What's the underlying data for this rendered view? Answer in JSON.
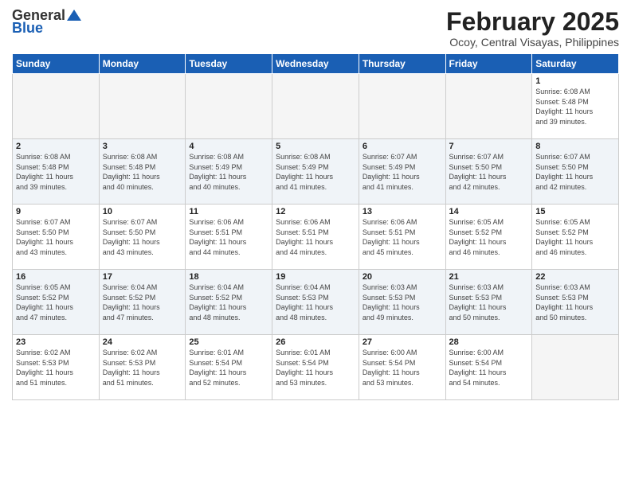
{
  "logo": {
    "general": "General",
    "blue": "Blue"
  },
  "header": {
    "month_year": "February 2025",
    "location": "Ocoy, Central Visayas, Philippines"
  },
  "weekdays": [
    "Sunday",
    "Monday",
    "Tuesday",
    "Wednesday",
    "Thursday",
    "Friday",
    "Saturday"
  ],
  "weeks": [
    [
      {
        "day": "",
        "info": ""
      },
      {
        "day": "",
        "info": ""
      },
      {
        "day": "",
        "info": ""
      },
      {
        "day": "",
        "info": ""
      },
      {
        "day": "",
        "info": ""
      },
      {
        "day": "",
        "info": ""
      },
      {
        "day": "1",
        "info": "Sunrise: 6:08 AM\nSunset: 5:48 PM\nDaylight: 11 hours\nand 39 minutes."
      }
    ],
    [
      {
        "day": "2",
        "info": "Sunrise: 6:08 AM\nSunset: 5:48 PM\nDaylight: 11 hours\nand 39 minutes."
      },
      {
        "day": "3",
        "info": "Sunrise: 6:08 AM\nSunset: 5:48 PM\nDaylight: 11 hours\nand 40 minutes."
      },
      {
        "day": "4",
        "info": "Sunrise: 6:08 AM\nSunset: 5:49 PM\nDaylight: 11 hours\nand 40 minutes."
      },
      {
        "day": "5",
        "info": "Sunrise: 6:08 AM\nSunset: 5:49 PM\nDaylight: 11 hours\nand 41 minutes."
      },
      {
        "day": "6",
        "info": "Sunrise: 6:07 AM\nSunset: 5:49 PM\nDaylight: 11 hours\nand 41 minutes."
      },
      {
        "day": "7",
        "info": "Sunrise: 6:07 AM\nSunset: 5:50 PM\nDaylight: 11 hours\nand 42 minutes."
      },
      {
        "day": "8",
        "info": "Sunrise: 6:07 AM\nSunset: 5:50 PM\nDaylight: 11 hours\nand 42 minutes."
      }
    ],
    [
      {
        "day": "9",
        "info": "Sunrise: 6:07 AM\nSunset: 5:50 PM\nDaylight: 11 hours\nand 43 minutes."
      },
      {
        "day": "10",
        "info": "Sunrise: 6:07 AM\nSunset: 5:50 PM\nDaylight: 11 hours\nand 43 minutes."
      },
      {
        "day": "11",
        "info": "Sunrise: 6:06 AM\nSunset: 5:51 PM\nDaylight: 11 hours\nand 44 minutes."
      },
      {
        "day": "12",
        "info": "Sunrise: 6:06 AM\nSunset: 5:51 PM\nDaylight: 11 hours\nand 44 minutes."
      },
      {
        "day": "13",
        "info": "Sunrise: 6:06 AM\nSunset: 5:51 PM\nDaylight: 11 hours\nand 45 minutes."
      },
      {
        "day": "14",
        "info": "Sunrise: 6:05 AM\nSunset: 5:52 PM\nDaylight: 11 hours\nand 46 minutes."
      },
      {
        "day": "15",
        "info": "Sunrise: 6:05 AM\nSunset: 5:52 PM\nDaylight: 11 hours\nand 46 minutes."
      }
    ],
    [
      {
        "day": "16",
        "info": "Sunrise: 6:05 AM\nSunset: 5:52 PM\nDaylight: 11 hours\nand 47 minutes."
      },
      {
        "day": "17",
        "info": "Sunrise: 6:04 AM\nSunset: 5:52 PM\nDaylight: 11 hours\nand 47 minutes."
      },
      {
        "day": "18",
        "info": "Sunrise: 6:04 AM\nSunset: 5:52 PM\nDaylight: 11 hours\nand 48 minutes."
      },
      {
        "day": "19",
        "info": "Sunrise: 6:04 AM\nSunset: 5:53 PM\nDaylight: 11 hours\nand 48 minutes."
      },
      {
        "day": "20",
        "info": "Sunrise: 6:03 AM\nSunset: 5:53 PM\nDaylight: 11 hours\nand 49 minutes."
      },
      {
        "day": "21",
        "info": "Sunrise: 6:03 AM\nSunset: 5:53 PM\nDaylight: 11 hours\nand 50 minutes."
      },
      {
        "day": "22",
        "info": "Sunrise: 6:03 AM\nSunset: 5:53 PM\nDaylight: 11 hours\nand 50 minutes."
      }
    ],
    [
      {
        "day": "23",
        "info": "Sunrise: 6:02 AM\nSunset: 5:53 PM\nDaylight: 11 hours\nand 51 minutes."
      },
      {
        "day": "24",
        "info": "Sunrise: 6:02 AM\nSunset: 5:53 PM\nDaylight: 11 hours\nand 51 minutes."
      },
      {
        "day": "25",
        "info": "Sunrise: 6:01 AM\nSunset: 5:54 PM\nDaylight: 11 hours\nand 52 minutes."
      },
      {
        "day": "26",
        "info": "Sunrise: 6:01 AM\nSunset: 5:54 PM\nDaylight: 11 hours\nand 53 minutes."
      },
      {
        "day": "27",
        "info": "Sunrise: 6:00 AM\nSunset: 5:54 PM\nDaylight: 11 hours\nand 53 minutes."
      },
      {
        "day": "28",
        "info": "Sunrise: 6:00 AM\nSunset: 5:54 PM\nDaylight: 11 hours\nand 54 minutes."
      },
      {
        "day": "",
        "info": ""
      }
    ]
  ]
}
